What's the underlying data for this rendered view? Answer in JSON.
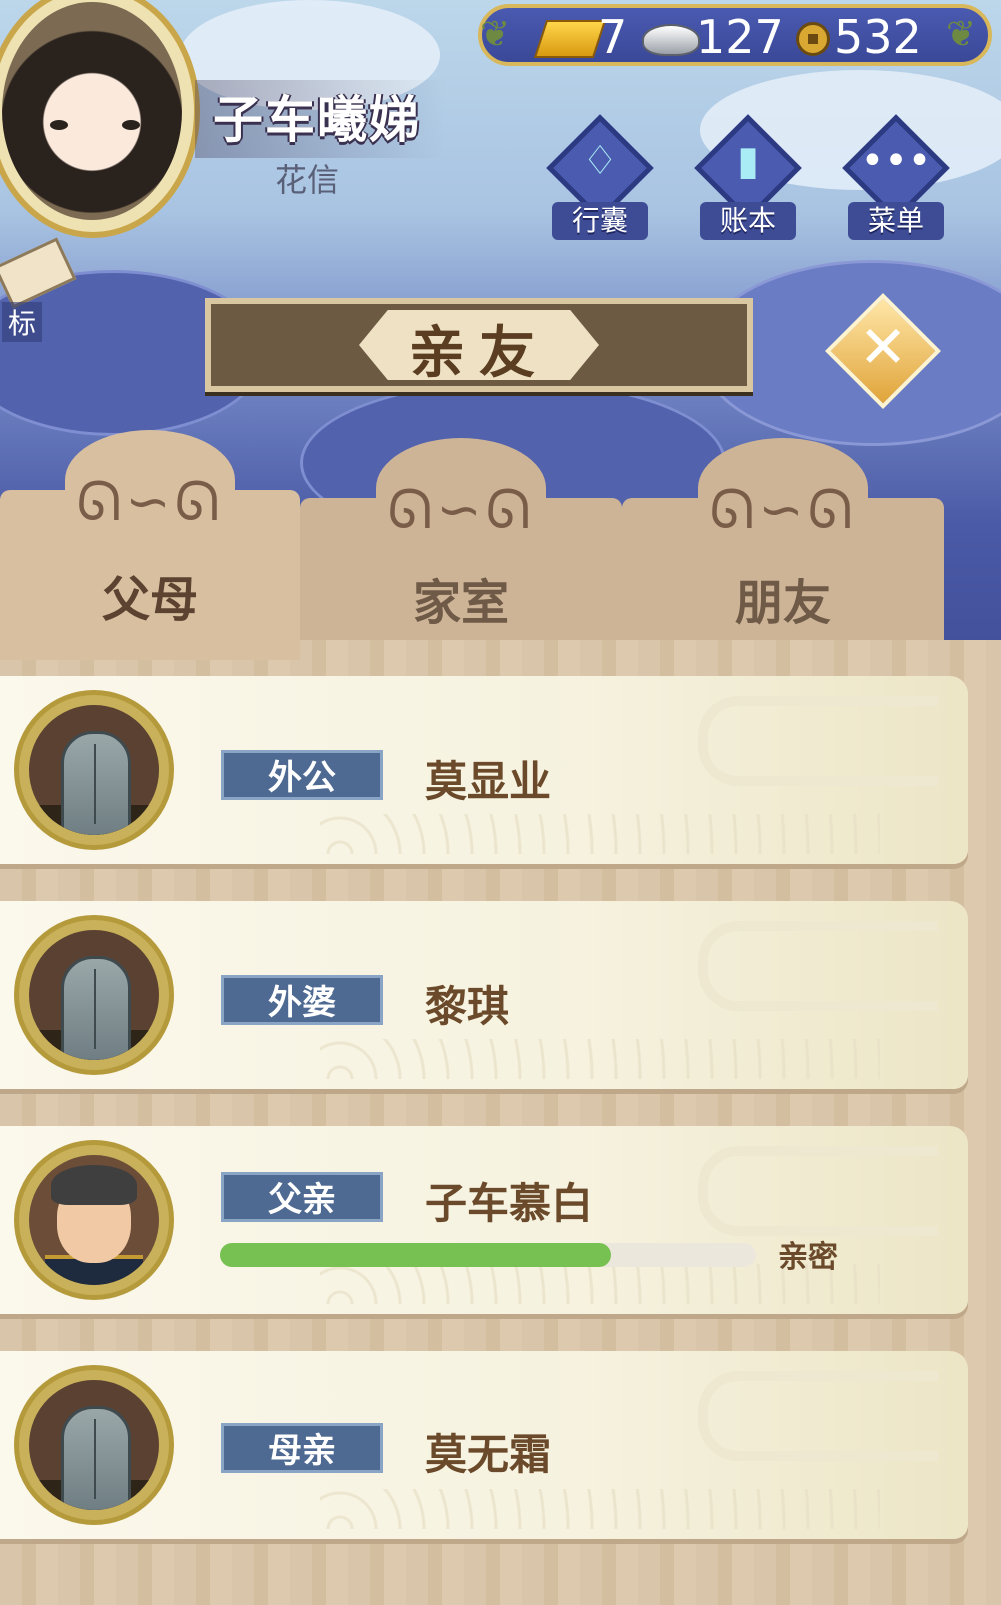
{
  "player": {
    "name": "子车曦娣",
    "title": "花信"
  },
  "currencies": [
    {
      "icon": "gold-ingot-icon",
      "value": "7"
    },
    {
      "icon": "silver-sycee-icon",
      "value": "127"
    },
    {
      "icon": "copper-coin-icon",
      "value": "532"
    }
  ],
  "menu": [
    {
      "icon": "bundle-icon",
      "label": "行囊"
    },
    {
      "icon": "ledger-icon",
      "label": "账本"
    },
    {
      "icon": "more-icon",
      "label": "菜单"
    }
  ],
  "side": {
    "label": "标"
  },
  "panel": {
    "title": "亲友",
    "tabs": [
      {
        "label": "父母",
        "active": true
      },
      {
        "label": "家室",
        "active": false
      },
      {
        "label": "朋友",
        "active": false
      }
    ]
  },
  "relatives": [
    {
      "relation": "外公",
      "name": "莫显业",
      "deceased": true
    },
    {
      "relation": "外婆",
      "name": "黎琪",
      "deceased": true
    },
    {
      "relation": "父亲",
      "name": "子车慕白",
      "deceased": false,
      "bond_label": "亲密",
      "bond_level": 0.73
    },
    {
      "relation": "母亲",
      "name": "莫无霜",
      "deceased": true
    }
  ],
  "colors": {
    "bond_fill": "#76c152",
    "relation_tag": "#4e6a92",
    "frame_gold": "#d8b85a"
  }
}
